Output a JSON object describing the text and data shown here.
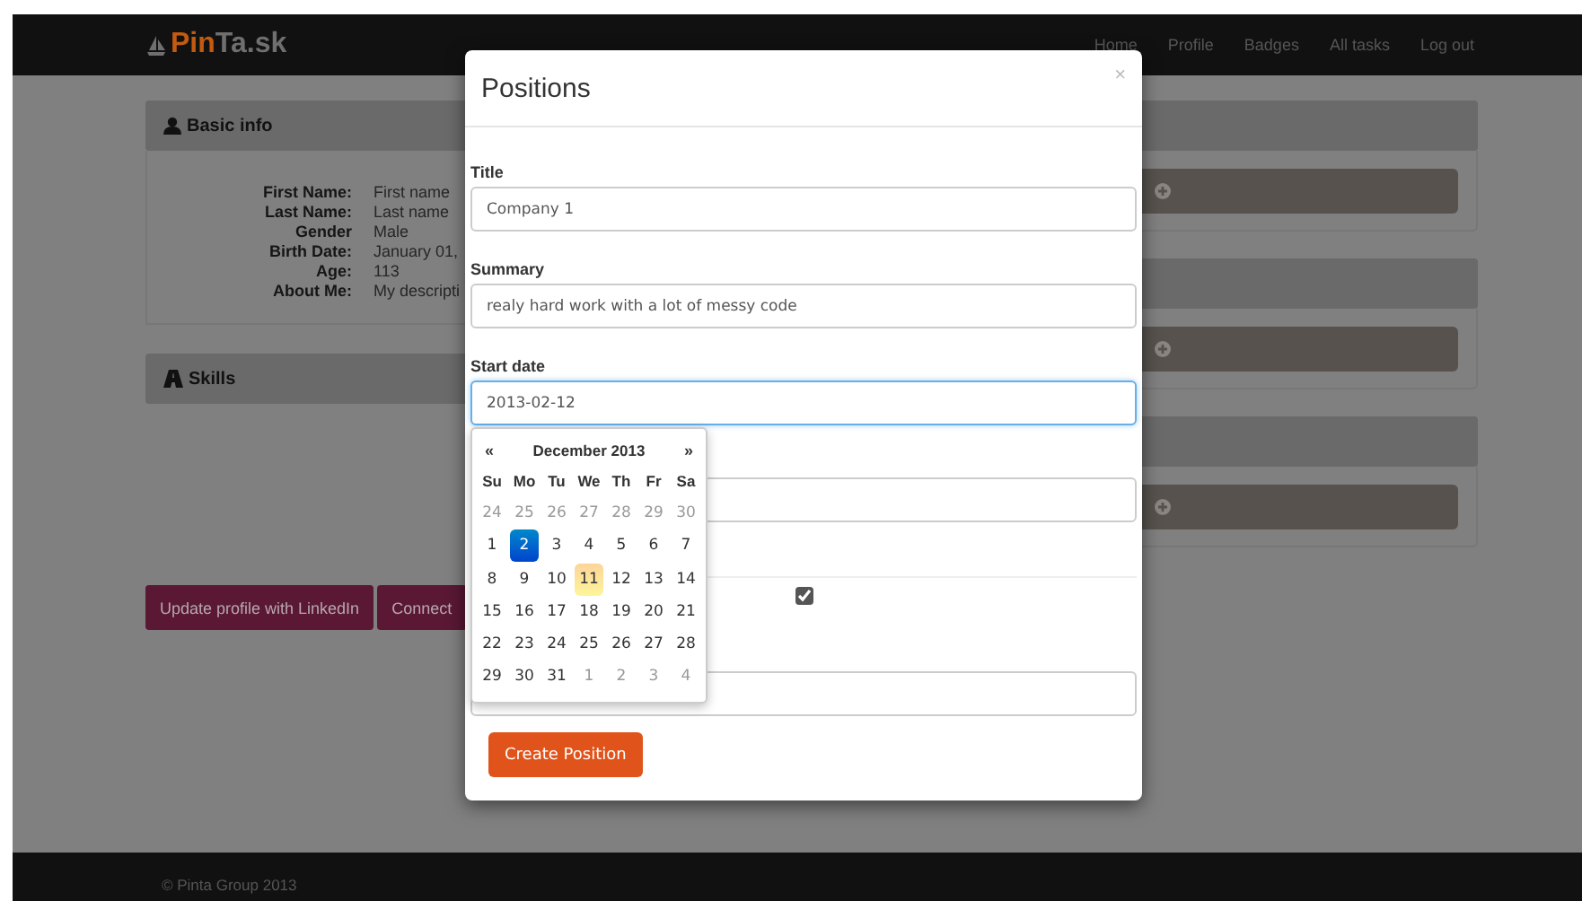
{
  "navbar": {
    "logo": [
      "Pin",
      "Ta.sk"
    ],
    "links": [
      "Home",
      "Profile",
      "Badges",
      "All tasks",
      "Log out"
    ]
  },
  "basic_info": {
    "title": "Basic info",
    "fields": [
      {
        "label": "First Name:",
        "value": "First name"
      },
      {
        "label": "Last Name:",
        "value": "Last name"
      },
      {
        "label": "Gender",
        "value": "Male"
      },
      {
        "label": "Birth Date:",
        "value": "January 01,"
      },
      {
        "label": "Age:",
        "value": "113"
      },
      {
        "label": "About Me:",
        "value": "My descripti"
      }
    ]
  },
  "skills": {
    "title": "Skills"
  },
  "buttons": [
    "Update profile with LinkedIn",
    "Connect"
  ],
  "footer": "© Pinta Group 2013",
  "modal": {
    "title": "Positions",
    "close": "×",
    "fields": [
      {
        "label": "Title",
        "value": "Company 1",
        "focused": false
      },
      {
        "label": "Summary",
        "value": "realy hard work with a lot of messy code",
        "focused": false
      },
      {
        "label": "Start date",
        "value": "2013-02-12",
        "focused": true
      }
    ],
    "checkbox": {
      "checked": true
    },
    "submit": "Create Position"
  },
  "datepicker": {
    "prev": "«",
    "month": "December 2013",
    "next": "»",
    "weekdays": [
      "Su",
      "Mo",
      "Tu",
      "We",
      "Th",
      "Fr",
      "Sa"
    ],
    "days": [
      {
        "text": "24",
        "muted": true,
        "selected": false,
        "today": false
      },
      {
        "text": "25",
        "muted": true,
        "selected": false,
        "today": false
      },
      {
        "text": "26",
        "muted": true,
        "selected": false,
        "today": false
      },
      {
        "text": "27",
        "muted": true,
        "selected": false,
        "today": false
      },
      {
        "text": "28",
        "muted": true,
        "selected": false,
        "today": false
      },
      {
        "text": "29",
        "muted": true,
        "selected": false,
        "today": false
      },
      {
        "text": "30",
        "muted": true,
        "selected": false,
        "today": false
      },
      {
        "text": "1",
        "muted": false,
        "selected": false,
        "today": false
      },
      {
        "text": "2",
        "muted": false,
        "selected": true,
        "today": false
      },
      {
        "text": "3",
        "muted": false,
        "selected": false,
        "today": false
      },
      {
        "text": "4",
        "muted": false,
        "selected": false,
        "today": false
      },
      {
        "text": "5",
        "muted": false,
        "selected": false,
        "today": false
      },
      {
        "text": "6",
        "muted": false,
        "selected": false,
        "today": false
      },
      {
        "text": "7",
        "muted": false,
        "selected": false,
        "today": false
      },
      {
        "text": "8",
        "muted": false,
        "selected": false,
        "today": false
      },
      {
        "text": "9",
        "muted": false,
        "selected": false,
        "today": false
      },
      {
        "text": "10",
        "muted": false,
        "selected": false,
        "today": false
      },
      {
        "text": "11",
        "muted": false,
        "selected": false,
        "today": true
      },
      {
        "text": "12",
        "muted": false,
        "selected": false,
        "today": false
      },
      {
        "text": "13",
        "muted": false,
        "selected": false,
        "today": false
      },
      {
        "text": "14",
        "muted": false,
        "selected": false,
        "today": false
      },
      {
        "text": "15",
        "muted": false,
        "selected": false,
        "today": false
      },
      {
        "text": "16",
        "muted": false,
        "selected": false,
        "today": false
      },
      {
        "text": "17",
        "muted": false,
        "selected": false,
        "today": false
      },
      {
        "text": "18",
        "muted": false,
        "selected": false,
        "today": false
      },
      {
        "text": "19",
        "muted": false,
        "selected": false,
        "today": false
      },
      {
        "text": "20",
        "muted": false,
        "selected": false,
        "today": false
      },
      {
        "text": "21",
        "muted": false,
        "selected": false,
        "today": false
      },
      {
        "text": "22",
        "muted": false,
        "selected": false,
        "today": false
      },
      {
        "text": "23",
        "muted": false,
        "selected": false,
        "today": false
      },
      {
        "text": "24",
        "muted": false,
        "selected": false,
        "today": false
      },
      {
        "text": "25",
        "muted": false,
        "selected": false,
        "today": false
      },
      {
        "text": "26",
        "muted": false,
        "selected": false,
        "today": false
      },
      {
        "text": "27",
        "muted": false,
        "selected": false,
        "today": false
      },
      {
        "text": "28",
        "muted": false,
        "selected": false,
        "today": false
      },
      {
        "text": "29",
        "muted": false,
        "selected": false,
        "today": false
      },
      {
        "text": "30",
        "muted": false,
        "selected": false,
        "today": false
      },
      {
        "text": "31",
        "muted": false,
        "selected": false,
        "today": false
      },
      {
        "text": "1",
        "muted": true,
        "selected": false,
        "today": false
      },
      {
        "text": "2",
        "muted": true,
        "selected": false,
        "today": false
      },
      {
        "text": "3",
        "muted": true,
        "selected": false,
        "today": false
      },
      {
        "text": "4",
        "muted": true,
        "selected": false,
        "today": false
      }
    ]
  }
}
